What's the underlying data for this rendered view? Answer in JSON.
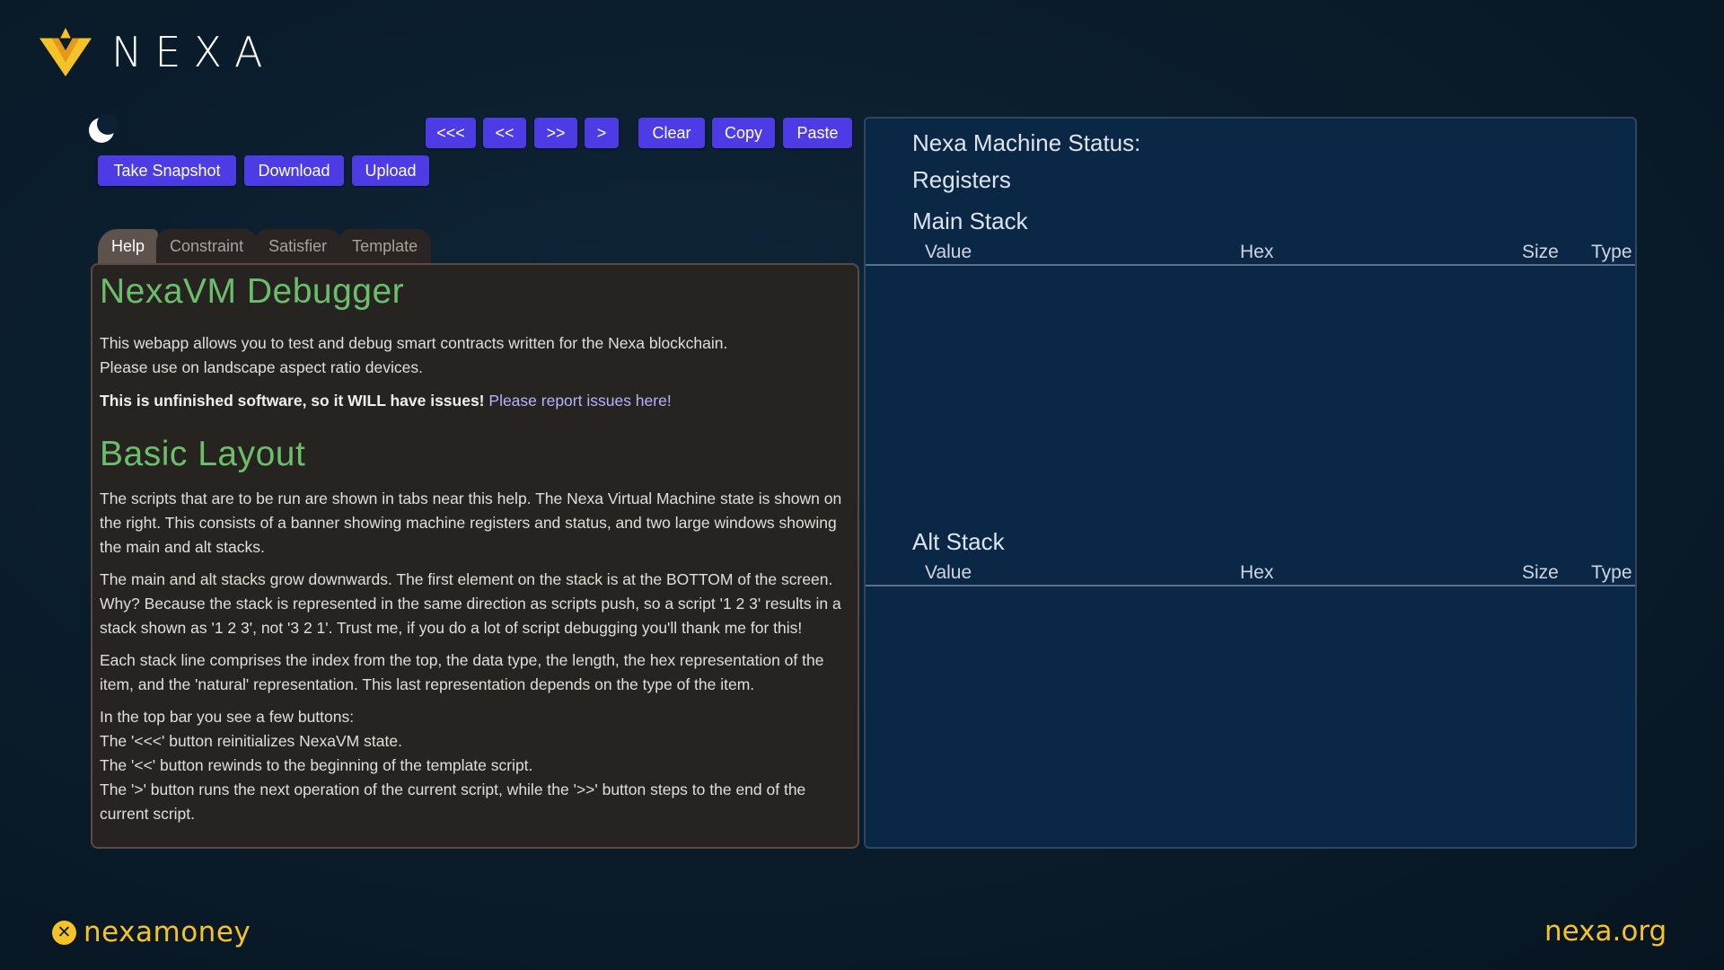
{
  "brand": {
    "name": "NEXA",
    "accent": "#f5c227"
  },
  "controls": {
    "theme_icon": "moon-icon",
    "nav": [
      "<<<",
      "<<",
      ">>",
      ">"
    ],
    "actions": [
      "Clear",
      "Copy",
      "Paste"
    ],
    "snapshot": "Take Snapshot",
    "download": "Download",
    "upload": "Upload"
  },
  "tabs": [
    {
      "label": "Help",
      "active": true
    },
    {
      "label": "Constraint",
      "active": false
    },
    {
      "label": "Satisfier",
      "active": false
    },
    {
      "label": "Template",
      "active": false
    }
  ],
  "help": {
    "title": "NexaVM Debugger",
    "intro1": "This webapp allows you to test and debug smart contracts written for the Nexa blockchain.",
    "intro2": "Please use on landscape aspect ratio devices.",
    "warning": "This is unfinished software, so it WILL have issues!",
    "report_link": "Please report issues here!",
    "layout_title": "Basic Layout",
    "p1": "The scripts that are to be run are shown in tabs near this help. The Nexa Virtual Machine state is shown on the right. This consists of a banner showing machine registers and status, and two large windows showing the main and alt stacks.",
    "p2": "The main and alt stacks grow downwards. The first element on the stack is at the BOTTOM of the screen. Why? Because the stack is represented in the same direction as scripts push, so a script '1 2 3' results in a stack shown as '1 2 3', not '3 2 1'. Trust me, if you do a lot of script debugging you'll thank me for this!",
    "p3": "Each stack line comprises the index from the top, the data type, the length, the hex representation of the item, and the 'natural' representation. This last representation depends on the type of the item.",
    "buttons_intro": "In the top bar you see a few buttons:",
    "btn_line1": "The '<<<' button reinitializes NexaVM state.",
    "btn_line2": "The '<<' button rewinds to the beginning of the template script.",
    "btn_line3": "The '>' button runs the next operation of the current script, while the '>>' button steps to the end of the current script."
  },
  "status": {
    "title": "Nexa Machine Status:",
    "registers": "Registers",
    "main_stack": "Main Stack",
    "alt_stack": "Alt Stack",
    "columns": [
      "Value",
      "Hex",
      "Size",
      "Type"
    ]
  },
  "footer": {
    "left": "nexamoney",
    "left_icon": "x-coin-icon",
    "right": "nexa.org"
  }
}
